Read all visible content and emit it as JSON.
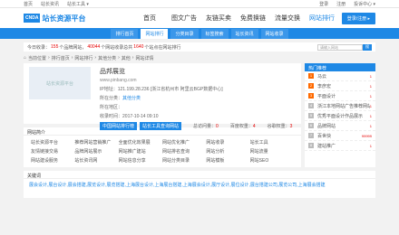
{
  "topbar": {
    "left": [
      "首页",
      "站长资讯",
      "站长工具 ▾"
    ],
    "right": [
      "登录",
      "注册",
      "投诉中心 ▾"
    ]
  },
  "header": {
    "logo_badge": "CNDA",
    "logo_text": "站长资源平台",
    "nav": [
      "首页",
      "图文广告",
      "友链买卖",
      "免费换链",
      "流量交换",
      "网站排行"
    ],
    "active_nav": 5,
    "login_button": "登录/注册 ▸"
  },
  "subnav": {
    "items": [
      "排行首页",
      "网站排行",
      "分类目录",
      "标签搜索",
      "站长资讯",
      "网站收录"
    ],
    "active": 1
  },
  "notice": {
    "prefix": "今日收录：",
    "today": "155",
    "mid": "个品牌网站，",
    "total": "40044",
    "mid2": "个网站收录总共",
    "sites": "1640",
    "suffix": "个站点在网站排行",
    "search_placeholder": "请输入网站",
    "search_button": "搜"
  },
  "breadcrumb": [
    "当前位置",
    "排行首页",
    "网站排行",
    "其他分类",
    "其他",
    "网站详情"
  ],
  "site": {
    "thumb_text": "站长资源平台",
    "name": "品邦展览",
    "url": "www.pinbang.com",
    "ip_label": "IP地址：",
    "ip": "121.199.28.236 [浙江省杭州市 阿里云BGP数据中心]",
    "category_label": "所在分类：",
    "category": "其他分类",
    "region_label": "所在地区：",
    "region": "",
    "time_label": "收录时间：",
    "time": "2017-10-14 09:10",
    "tag1": "中国网站排行榜",
    "tag2": "站长工具查询网站",
    "metric1_label": "总访问量：",
    "metric1": "0",
    "metric2_label": "百度权重：",
    "metric2": "4",
    "metric3_label": "谷歌权重：",
    "metric3": "3"
  },
  "intro": {
    "title": "网站简介",
    "items": [
      "站长资源平台",
      "推荐网站营销推广",
      "全面优化效果展",
      "网站优化推广",
      "网站收录",
      "站长工具",
      "友情链接交易",
      "品牌网站展示",
      "网站推广建站",
      "网站排名查询",
      "网站分析",
      "网站流量",
      "网站建设服务",
      "站长资讯网",
      "网站信息分享",
      "网站分类目录",
      "网站模板",
      "网站SEO"
    ]
  },
  "side": {
    "title": "热门推荐",
    "items": [
      {
        "n": "1",
        "name": "马云",
        "val": "1"
      },
      {
        "n": "2",
        "name": "李彦宏",
        "val": "1"
      },
      {
        "n": "3",
        "name": "平面设计",
        "val": "1"
      },
      {
        "n": "4",
        "name": "浙江本地网站广告推荐网站",
        "val": "1"
      },
      {
        "n": "5",
        "name": "优秀平面设计作品展示",
        "val": "1"
      },
      {
        "n": "6",
        "name": "品牌网站",
        "val": "1"
      },
      {
        "n": "7",
        "name": "百世快",
        "val": "99999"
      },
      {
        "n": "8",
        "name": "建站推广",
        "val": "1"
      }
    ]
  },
  "keywords": {
    "title": "关键词",
    "text": "展会设计,展台设计,展会搭建,展览设计,展览搭建,上海展台设计,上海展台搭建,上海展会设计,展厅设计,展位设计,展台搭建公司,展览公司,上海展会搭建"
  }
}
